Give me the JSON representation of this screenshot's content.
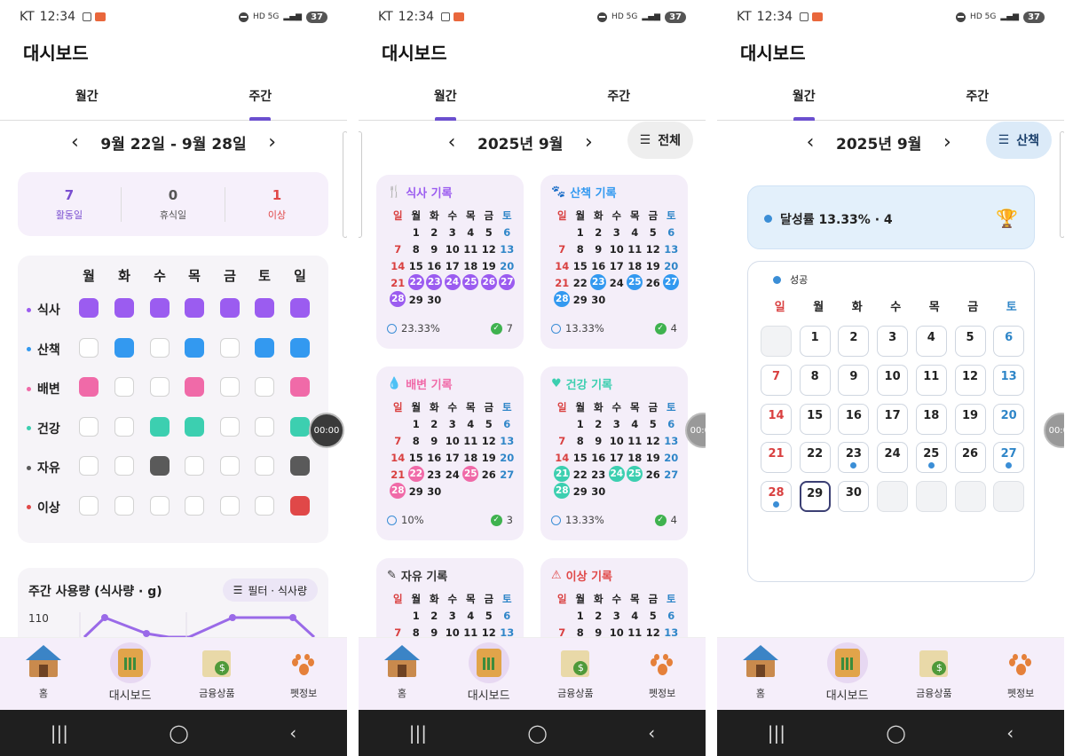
{
  "status": {
    "carrier": "KT",
    "time": "12:34",
    "battery": "37",
    "net": "HD 5G"
  },
  "app_title": "대시보드",
  "tabs": {
    "monthly": "월간",
    "weekly": "주간"
  },
  "nav": {
    "bottom": [
      {
        "label": "홈",
        "icon": "home-icon"
      },
      {
        "label": "대시보드",
        "icon": "dashboard-icon"
      },
      {
        "label": "금융상품",
        "icon": "finance-icon"
      },
      {
        "label": "펫정보",
        "icon": "pet-paw-icon"
      }
    ]
  },
  "screen1": {
    "week_label": "9월 22일 - 9월 28일",
    "summary": [
      {
        "num": "7",
        "label": "활동일",
        "color": "#7a4fd0"
      },
      {
        "num": "0",
        "label": "휴식일",
        "color": "#555555"
      },
      {
        "num": "1",
        "label": "이상",
        "color": "#e04848"
      }
    ],
    "days": [
      "월",
      "화",
      "수",
      "목",
      "금",
      "토",
      "일"
    ],
    "rows": [
      {
        "label": "식사",
        "color": "#9b5cf0",
        "cells": [
          1,
          1,
          1,
          1,
          1,
          1,
          1
        ]
      },
      {
        "label": "산책",
        "color": "#3399f0",
        "cells": [
          0,
          1,
          0,
          1,
          0,
          1,
          1
        ]
      },
      {
        "label": "배변",
        "color": "#f06aa8",
        "cells": [
          1,
          0,
          0,
          1,
          0,
          0,
          1
        ]
      },
      {
        "label": "건강",
        "color": "#3ccfb0",
        "cells": [
          0,
          0,
          1,
          1,
          0,
          0,
          1
        ]
      },
      {
        "label": "자유",
        "color": "#5a5a5a",
        "cells": [
          0,
          0,
          1,
          0,
          0,
          0,
          1
        ]
      },
      {
        "label": "이상",
        "color": "#e04848",
        "cells": [
          0,
          0,
          0,
          0,
          0,
          0,
          1
        ]
      }
    ],
    "usage_title": "주간 사용량 (식사량 · g)",
    "usage_filter": "필터 · 식사량",
    "usage_ytick": "110",
    "timer": "00:00"
  },
  "screen2": {
    "month_label": "2025년 9월",
    "filter": "전체",
    "weekdays": [
      "일",
      "월",
      "화",
      "수",
      "목",
      "금",
      "토"
    ],
    "cards": [
      {
        "title": "식사 기록",
        "icon": "fork-knife-icon",
        "color": "#9b5cf0",
        "hl": [
          22,
          23,
          24,
          25,
          26,
          27,
          28
        ],
        "pct": "23.33%",
        "count": "7"
      },
      {
        "title": "산책 기록",
        "icon": "paw-icon",
        "color": "#3399f0",
        "hl": [
          23,
          25,
          27,
          28
        ],
        "pct": "13.33%",
        "count": "4"
      },
      {
        "title": "배변 기록",
        "icon": "drop-icon",
        "color": "#f06aa8",
        "hl": [
          22,
          25,
          28
        ],
        "pct": "10%",
        "count": "3"
      },
      {
        "title": "건강 기록",
        "icon": "heart-icon",
        "color": "#3ccfb0",
        "hl": [
          21,
          24,
          25,
          28
        ],
        "pct": "13.33%",
        "count": "4"
      },
      {
        "title": "자유 기록",
        "icon": "pencil-note-icon",
        "color": "#333333",
        "hl": [],
        "pct": "",
        "count": ""
      },
      {
        "title": "이상 기록",
        "icon": "warning-icon",
        "color": "#e04848",
        "hl": [],
        "pct": "",
        "count": ""
      }
    ],
    "timer": "00:00"
  },
  "screen3": {
    "month_label": "2025년 9월",
    "filter": "산책",
    "achievement": "달성률 13.33% · 4",
    "legend": "성공",
    "weekdays": [
      "일",
      "월",
      "화",
      "수",
      "목",
      "금",
      "토"
    ],
    "dots": [
      23,
      25,
      27,
      28
    ],
    "today": 29
  },
  "colors": {
    "sunday": "#d94040",
    "saturday": "#2f86c8",
    "accent": "#6b4fcf"
  }
}
